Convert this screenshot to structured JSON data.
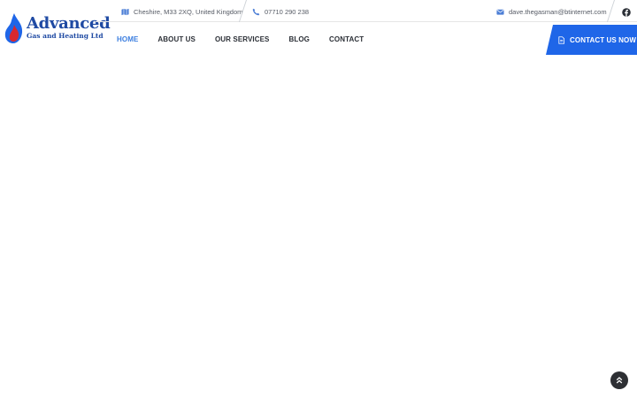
{
  "brand": {
    "name": "Advanced",
    "tagline": "Gas and Heating Ltd",
    "colors": {
      "primary": "#1f66e8",
      "logo_text": "#1f4aa3",
      "flame_red": "#d7282f",
      "flame_blue": "#1f66e8"
    }
  },
  "topbar": {
    "address": {
      "icon": "map-icon",
      "text": "Cheshire, M33 2XQ, United Kingdom"
    },
    "phone": {
      "icon": "phone-icon",
      "text": "07710 290 238"
    },
    "email": {
      "icon": "envelope-icon",
      "text": "dave.thegasman@btinternet.com"
    },
    "social": [
      {
        "icon": "facebook-icon"
      }
    ]
  },
  "nav": {
    "items": [
      {
        "label": "HOME",
        "active": true
      },
      {
        "label": "ABOUT US",
        "active": false
      },
      {
        "label": "OUR SERVICES",
        "active": false
      },
      {
        "label": "BLOG",
        "active": false
      },
      {
        "label": "CONTACT",
        "active": false
      }
    ]
  },
  "cta": {
    "icon": "document-icon",
    "label": "CONTACT US NOW"
  },
  "back_to_top": {
    "icon": "chevron-double-up-icon"
  }
}
